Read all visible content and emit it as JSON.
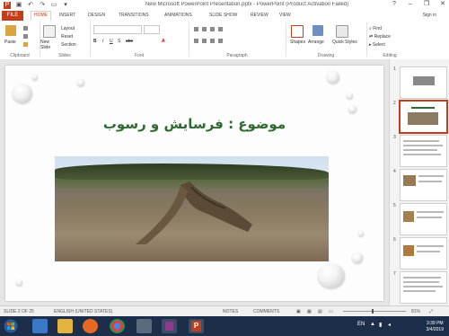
{
  "titlebar": {
    "title": "New Microsoft PowerPoint Presentation.pptx - PowerPoint (Product Activation Failed)",
    "controls": [
      "?",
      "–",
      "❐",
      "✕"
    ]
  },
  "tabs": {
    "file": "FILE",
    "items": [
      "HOME",
      "INSERT",
      "DESIGN",
      "TRANSITIONS",
      "ANIMATIONS",
      "SLIDE SHOW",
      "REVIEW",
      "VIEW"
    ],
    "active": "HOME",
    "signin": "Sign in"
  },
  "ribbon": {
    "clipboard": {
      "label": "Clipboard",
      "paste": "Paste"
    },
    "slides": {
      "label": "Slides",
      "new_slide": "New Slide",
      "layout": "Layout",
      "reset": "Reset",
      "section": "Section"
    },
    "font": {
      "label": "Font"
    },
    "paragraph": {
      "label": "Paragraph"
    },
    "drawing": {
      "label": "Drawing",
      "shapes": "Shapes",
      "arrange": "Arrange",
      "quick_styles": "Quick Styles"
    },
    "editing": {
      "label": "Editing",
      "find": "Find",
      "replace": "Replace",
      "select": "Select"
    }
  },
  "slide": {
    "title": "موضوع : فرسایش و رسوب"
  },
  "thumbnails": [
    {
      "num": "1"
    },
    {
      "num": "2"
    },
    {
      "num": "3"
    },
    {
      "num": "4"
    },
    {
      "num": "5"
    },
    {
      "num": "6"
    },
    {
      "num": "7"
    }
  ],
  "status": {
    "slide_info": "SLIDE 2 OF 25",
    "language": "ENGLISH (UNITED STATES)",
    "notes": "NOTES",
    "comments": "COMMENTS",
    "zoom": "81%"
  },
  "taskbar": {
    "lang": "EN",
    "time": "3:39 PM",
    "date": "3/4/2019"
  },
  "colors": {
    "accent": "#c43e1c",
    "title_green": "#2e6b2e",
    "taskbar": "#1c2e4a"
  }
}
